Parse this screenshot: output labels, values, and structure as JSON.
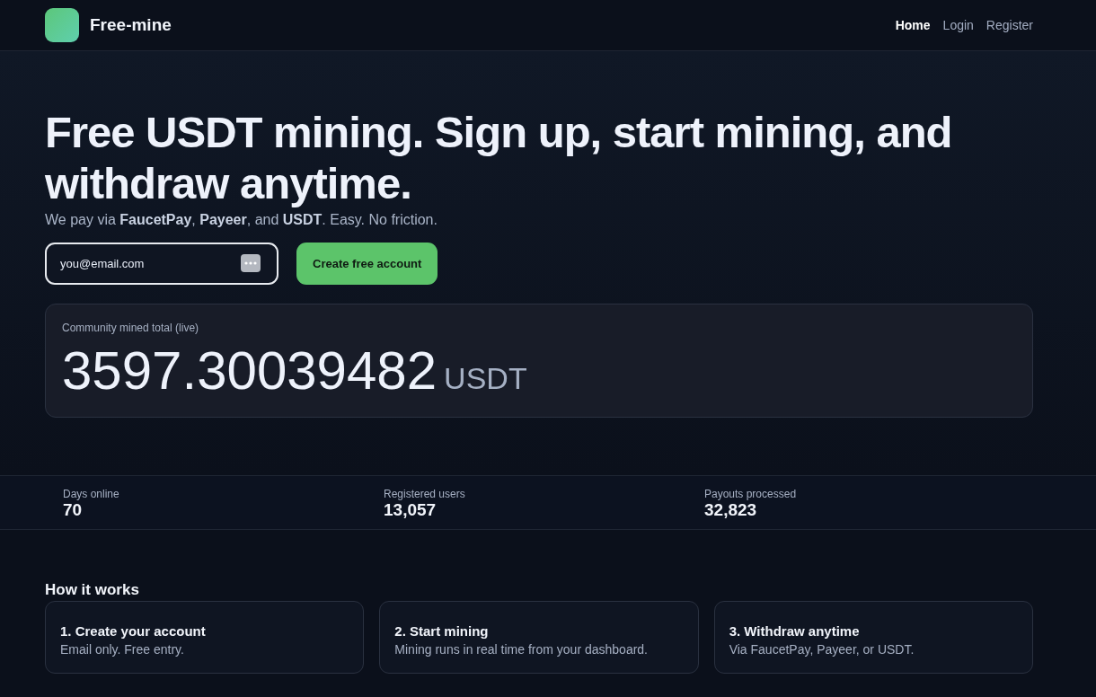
{
  "header": {
    "brand": "Free-mine",
    "nav": [
      {
        "label": "Home",
        "selected": true
      },
      {
        "label": "Login",
        "selected": false
      },
      {
        "label": "Register",
        "selected": false
      }
    ]
  },
  "hero": {
    "title": "Free USDT mining. Sign up, start mining, and withdraw anytime.",
    "subtitle": "We pay via **FaucetPay**, **Payeer**, and **USDT**. Easy. No friction.",
    "email": {
      "placeholder": "you@email.com"
    },
    "cta": "Create free account"
  },
  "counter": {
    "label": "Community mined total (live)",
    "value": "3597.30039482",
    "unit": "USDT"
  },
  "stats": [
    {
      "label": "Days online",
      "value": "70"
    },
    {
      "label": "Registered users",
      "value": "13,057"
    },
    {
      "label": "Payouts processed",
      "value": "32,823"
    }
  ],
  "how_it_works": {
    "title": "How it works",
    "steps": [
      {
        "title": "1. Create your account",
        "text": "Email only. Free entry."
      },
      {
        "title": "2. Start mining",
        "text": "Mining runs in real time from your dashboard."
      },
      {
        "title": "3. Withdraw anytime",
        "text": "Via FaucetPay, Payeer, or USDT."
      }
    ]
  }
}
